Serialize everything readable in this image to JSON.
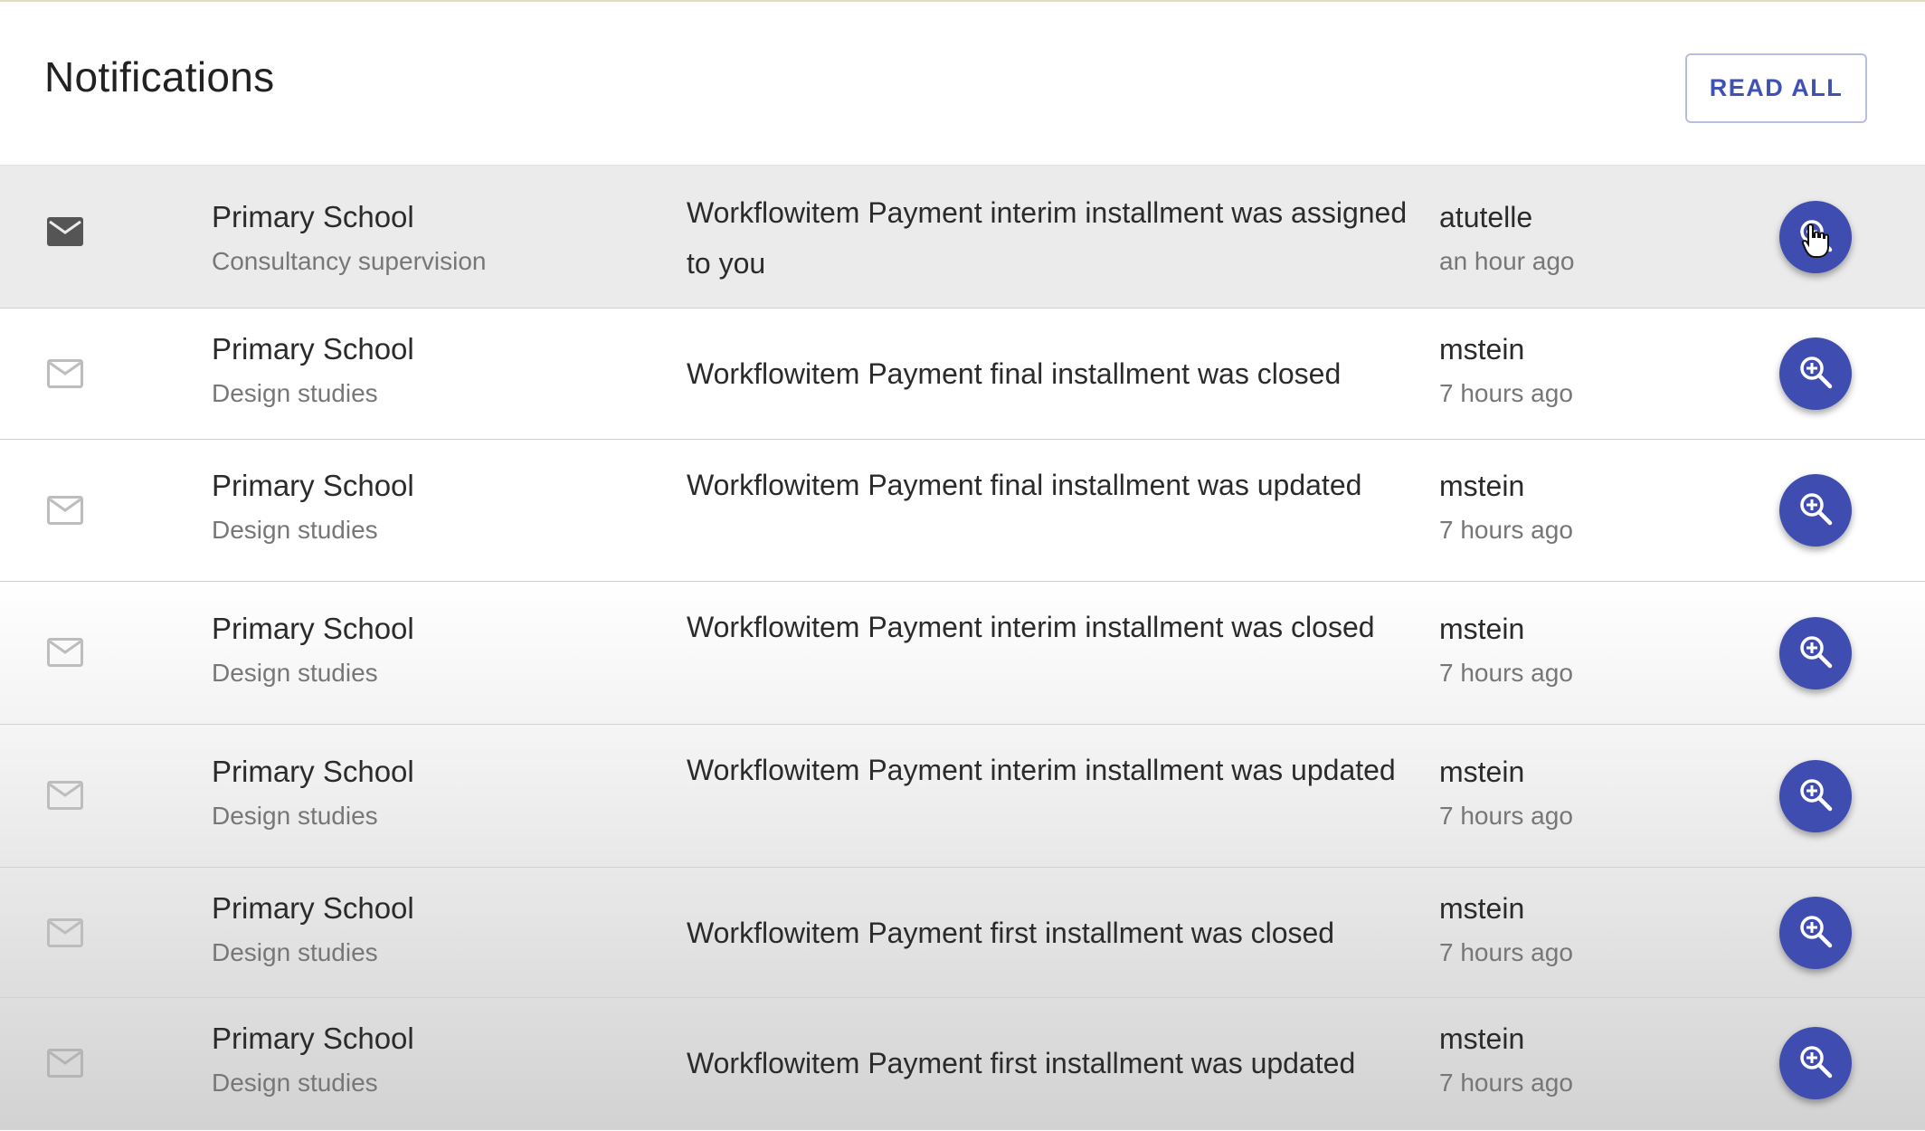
{
  "header": {
    "title": "Notifications",
    "read_all_label": "READ ALL"
  },
  "colors": {
    "accent": "#3f51b5",
    "button_bg": "#3f4cb0",
    "unread_row_bg": "#ebebeb"
  },
  "notifications": [
    {
      "status": "unread",
      "icon": "mail-filled-icon",
      "project": "Primary School",
      "subproject": "Consultancy supervision",
      "message": "Workflowitem Payment interim installment was assigned to you",
      "user": "atutelle",
      "time": "an hour ago"
    },
    {
      "status": "read",
      "icon": "mail-outline-icon",
      "project": "Primary School",
      "subproject": "Design studies",
      "message": "Workflowitem Payment final installment was closed",
      "user": "mstein",
      "time": "7 hours ago"
    },
    {
      "status": "read",
      "icon": "mail-outline-icon",
      "project": "Primary School",
      "subproject": "Design studies",
      "message": "Workflowitem Payment final installment was updated",
      "user": "mstein",
      "time": "7 hours ago"
    },
    {
      "status": "read",
      "icon": "mail-outline-icon",
      "project": "Primary School",
      "subproject": "Design studies",
      "message": "Workflowitem Payment interim installment was closed",
      "user": "mstein",
      "time": "7 hours ago"
    },
    {
      "status": "read",
      "icon": "mail-outline-icon",
      "project": "Primary School",
      "subproject": "Design studies",
      "message": "Workflowitem Payment interim installment was updated",
      "user": "mstein",
      "time": "7 hours ago"
    },
    {
      "status": "read",
      "icon": "mail-outline-icon",
      "project": "Primary School",
      "subproject": "Design studies",
      "message": "Workflowitem Payment first installment was closed",
      "user": "mstein",
      "time": "7 hours ago"
    },
    {
      "status": "read",
      "icon": "mail-outline-icon",
      "project": "Primary School",
      "subproject": "Design studies",
      "message": "Workflowitem Payment first installment was updated",
      "user": "mstein",
      "time": "7 hours ago"
    }
  ]
}
